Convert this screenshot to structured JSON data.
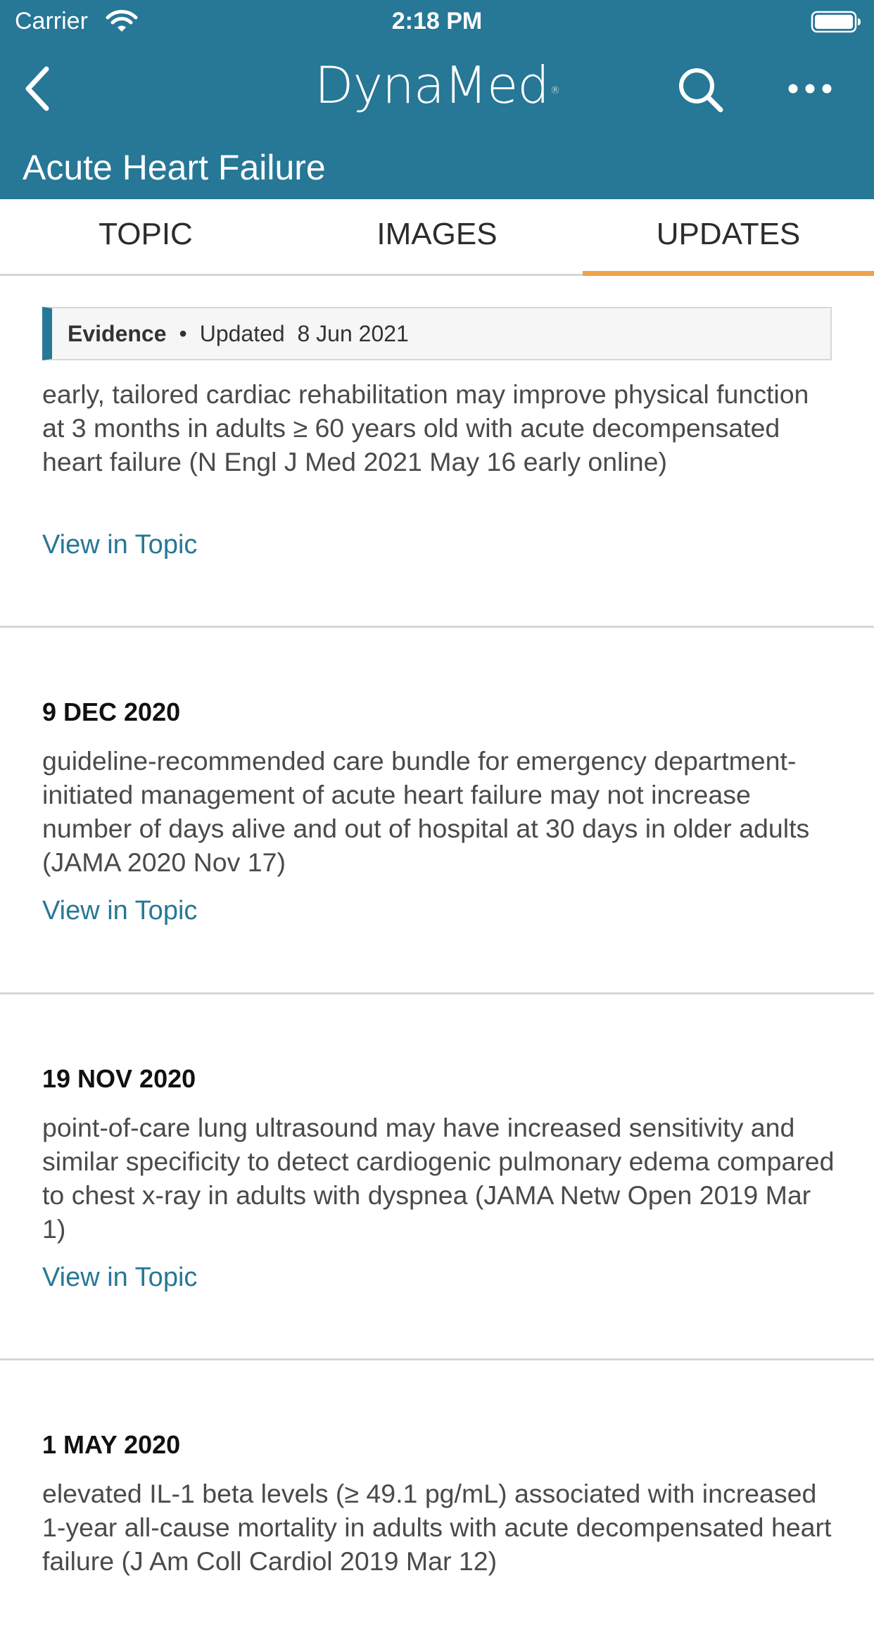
{
  "status_bar": {
    "carrier": "Carrier",
    "time": "2:18 PM"
  },
  "header": {
    "brand": "DynaMed",
    "brand_mark": "®",
    "title": "Acute Heart Failure",
    "icons": [
      "back-chevron-icon",
      "search-icon",
      "more-icon"
    ]
  },
  "tabs": [
    {
      "label": "TOPIC",
      "active": false
    },
    {
      "label": "IMAGES",
      "active": false
    },
    {
      "label": "UPDATES",
      "active": true
    }
  ],
  "updates": [
    {
      "badge": "Evidence",
      "updated_label": "Updated",
      "date": "8 Jun 2021",
      "text": "early, tailored cardiac rehabilitation may improve physical function at 3 months in adults ≥ 60 years old with acute decompensated heart failure (N Engl J Med 2021 May 16 early online)",
      "link": "View in Topic"
    },
    {
      "date": "9 DEC 2020",
      "text": "guideline-recommended care bundle for emergency department-initiated management of acute heart failure may not increase number of days alive and out of hospital at 30 days in older adults (JAMA 2020 Nov 17)",
      "link": "View in Topic"
    },
    {
      "date": "19 NOV 2020",
      "text": "point-of-care lung ultrasound may have increased sensitivity and similar specificity to detect cardiogenic pulmonary edema compared to chest x-ray in adults with dyspnea (JAMA Netw Open 2019 Mar 1)",
      "link": "View in Topic"
    },
    {
      "date": "1 MAY 2020",
      "text": "elevated IL-1 beta levels (≥ 49.1 pg/mL) associated with increased 1-year all-cause mortality in adults with acute decompensated heart failure (J Am Coll Cardiol 2019 Mar 12)"
    }
  ],
  "colors": {
    "header": "#277796",
    "accent": "#f0a04b",
    "link": "#277796"
  }
}
